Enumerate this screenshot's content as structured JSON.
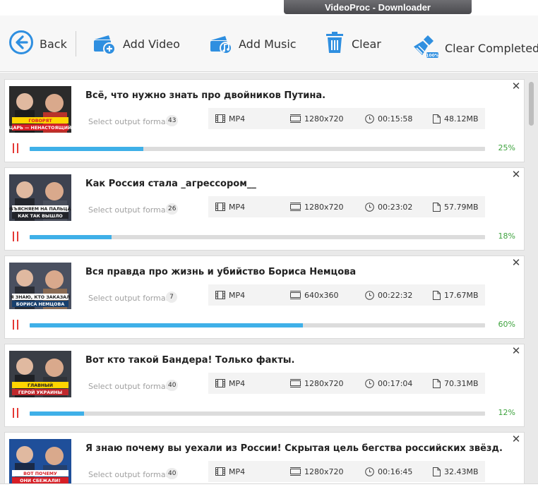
{
  "window": {
    "title": "VideoProc - Downloader"
  },
  "toolbar": {
    "back_label": "Back",
    "add_video_label": "Add Video",
    "add_music_label": "Add Music",
    "clear_label": "Clear",
    "clear_completed_label": "Clear Completed Ta",
    "accent": "#2f8fe0"
  },
  "colors": {
    "progress": "#3fb0e8",
    "percent": "#3ea33e",
    "pause": "#e53935"
  },
  "item_common": {
    "select_format_label": "Select output format"
  },
  "items": [
    {
      "title": "Всё, что нужно знать про двойников Путина.",
      "count": "43",
      "format": "MP4",
      "resolution": "1280x720",
      "duration": "00:15:58",
      "size": "48.12MB",
      "progress": 25,
      "percent": "25%",
      "thumb_text": [
        "ГОВОРЯТ",
        "ЦАРЬ — НЕНАСТОЯЩИЙ"
      ]
    },
    {
      "title": "Как Россия стала _агрессором__",
      "count": "26",
      "format": "MP4",
      "resolution": "1280x720",
      "duration": "00:23:02",
      "size": "57.79MB",
      "progress": 18,
      "percent": "18%",
      "thumb_text": [
        "ОБЪЯСНЯЕМ НА ПАЛЬЦАХ",
        "КАК ТАК ВЫШЛО"
      ]
    },
    {
      "title": "Вся правда про жизнь и убийство Бориса Немцова",
      "count": "7",
      "format": "MP4",
      "resolution": "640x360",
      "duration": "00:22:32",
      "size": "17.67MB",
      "progress": 60,
      "percent": "60%",
      "thumb_text": [
        "Я ЗНАЮ, КТО ЗАКАЗАЛ",
        "БОРИСА НЕМЦОВА"
      ]
    },
    {
      "title": "Вот кто такой Бандера! Только факты.",
      "count": "40",
      "format": "MP4",
      "resolution": "1280x720",
      "duration": "00:17:04",
      "size": "70.31MB",
      "progress": 12,
      "percent": "12%",
      "thumb_text": [
        "ГЛАВНЫЙ",
        "ГЕРОЙ УКРАИНЫ"
      ]
    },
    {
      "title": "Я знаю почему вы уехали из России! Скрытая цель бегства российских звёзд.",
      "count": "40",
      "format": "MP4",
      "resolution": "1280x720",
      "duration": "00:16:45",
      "size": "32.43MB",
      "progress": 0,
      "percent": "",
      "thumb_text": [
        "ВОТ ПОЧЕМУ",
        "ОНИ СБЕЖАЛИ!"
      ]
    }
  ]
}
